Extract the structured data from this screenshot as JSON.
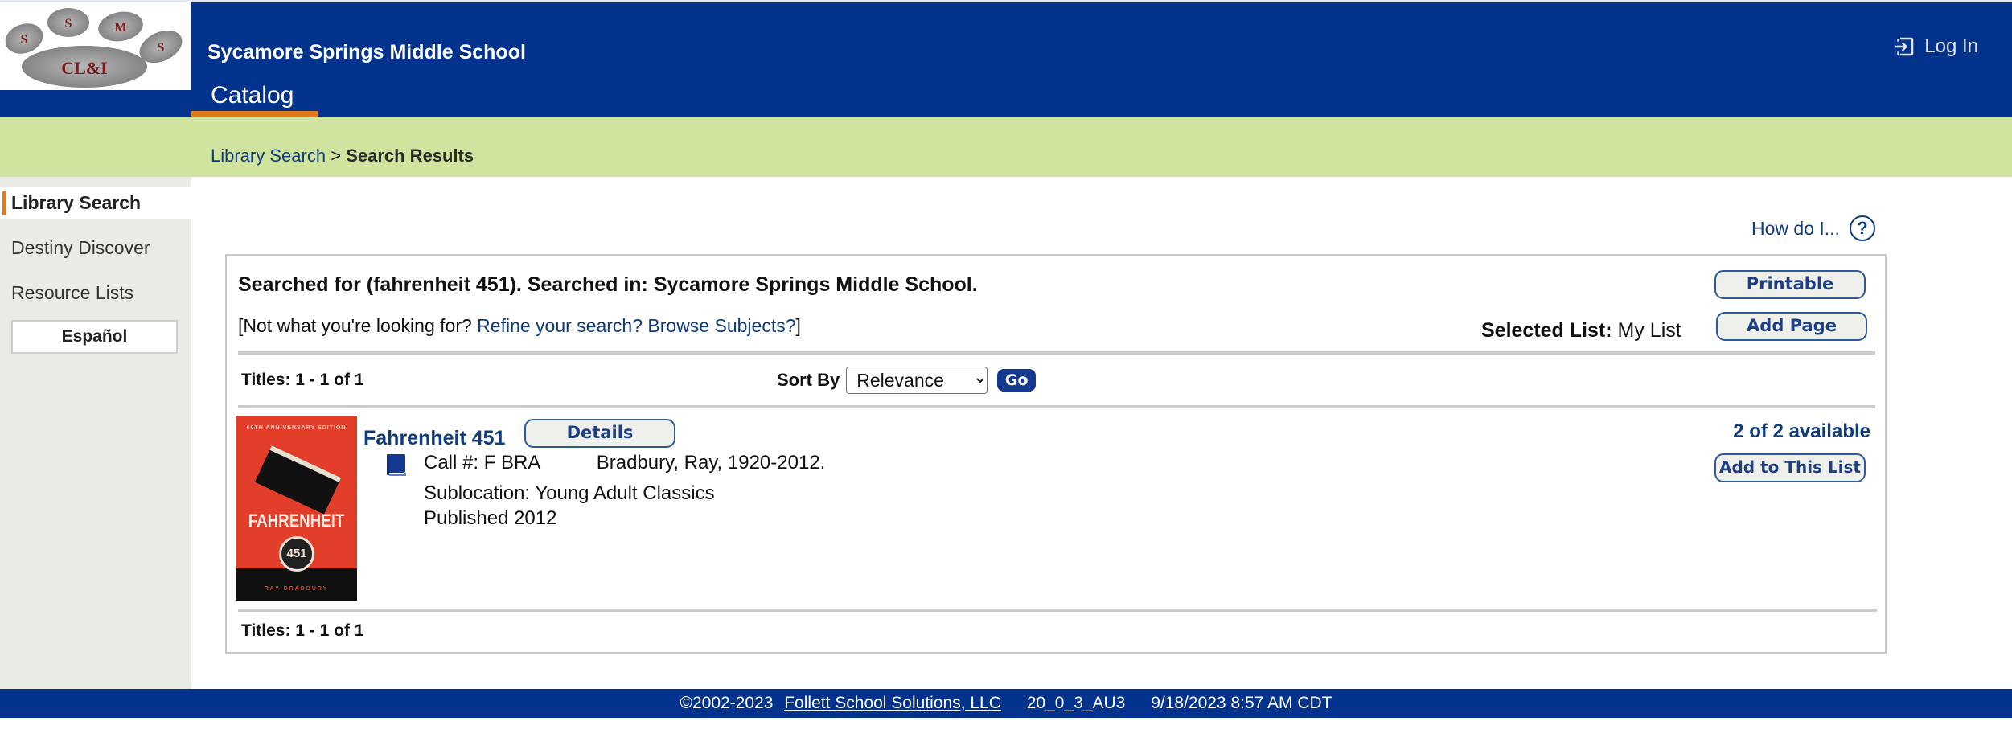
{
  "header": {
    "school_name": "Sycamore Springs Middle School",
    "logo_alt": "SSMS CL&I paw logo",
    "logo_letters": [
      "S",
      "S",
      "M",
      "S",
      "CL&I"
    ],
    "tab_catalog": "Catalog",
    "login_label": "Log In",
    "login_icon": "login-icon"
  },
  "breadcrumb": {
    "link": "Library Search",
    "separator": ">",
    "current": "Search Results"
  },
  "sidebar": {
    "items": [
      {
        "label": "Library Search",
        "active": true
      },
      {
        "label": "Destiny Discover",
        "active": false
      },
      {
        "label": "Resource Lists",
        "active": false
      }
    ],
    "language_button": "Español"
  },
  "help": {
    "label": "How do I...",
    "icon": "?"
  },
  "results": {
    "searched_text": "Searched for (fahrenheit 451). Searched in: Sycamore Springs Middle School.",
    "not_what_prefix": "[Not what you're looking for?",
    "refine_link": "Refine your search?",
    "browse_link": "Browse Subjects?",
    "not_what_suffix": "]",
    "selected_list_label": "Selected List:",
    "selected_list_value": "My List",
    "printable_button": "Printable",
    "add_page_button": "Add Page",
    "titles_count_top": "Titles: 1 - 1 of 1",
    "titles_count_bottom": "Titles: 1 - 1 of 1",
    "sort_by_label": "Sort By",
    "sort_by_value": "Relevance",
    "go_button": "Go",
    "items": [
      {
        "title": "Fahrenheit 451",
        "details_button": "Details",
        "call_number": "Call #: F BRA",
        "author": "Bradbury, Ray, 1920-2012.",
        "sublocation": "Sublocation: Young Adult Classics",
        "published": "Published 2012",
        "availability": "2 of 2 available",
        "add_to_list_button": "Add to This List",
        "cover": {
          "edition": "60TH ANNIVERSARY EDITION",
          "title": "FAHRENHEIT",
          "number": "451",
          "author": "RAY BRADBURY"
        }
      }
    ]
  },
  "footer": {
    "copyright": "©2002-2023",
    "company_link": "Follett School Solutions, LLC",
    "version": "20_0_3_AU3",
    "timestamp": "9/18/2023 8:57 AM CDT"
  },
  "colors": {
    "header_blue": "#03338c",
    "accent_orange": "#e07a18",
    "breadcrumb_green": "#d0e4a0",
    "link_blue": "#103c7c"
  }
}
